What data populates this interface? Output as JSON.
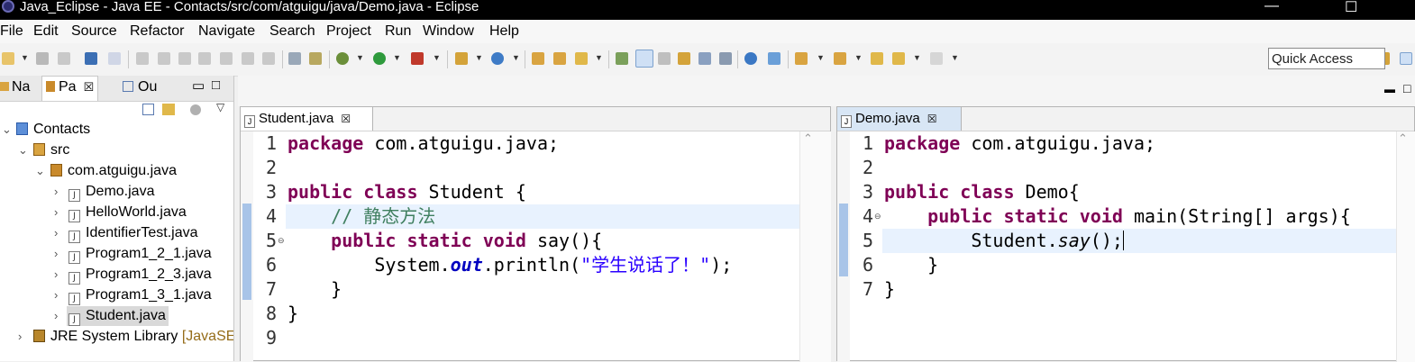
{
  "window": {
    "title": "Java_Eclipse - Java EE - Contacts/src/com/atguigu/java/Demo.java - Eclipse",
    "minimize": "—",
    "maximize": "☐"
  },
  "menubar": {
    "items": [
      "File",
      "Edit",
      "Source",
      "Refactor",
      "Navigate",
      "Search",
      "Project",
      "Run",
      "Window",
      "Help"
    ]
  },
  "toolbar": {
    "quick_access": "Quick Access"
  },
  "left_panel": {
    "tabs": [
      {
        "label": "Na",
        "icon": "navigator-icon"
      },
      {
        "label": "Pa",
        "icon": "package-explorer-icon"
      },
      {
        "label": "Ou",
        "icon": "outline-icon"
      }
    ],
    "close_glyph": "☒",
    "tree": [
      {
        "label": "Contacts",
        "icon": "project-icon"
      },
      {
        "label": "src",
        "icon": "source-folder-icon"
      },
      {
        "label": "com.atguigu.java",
        "icon": "package-icon"
      },
      {
        "label": "Demo.java",
        "icon": "java-file-icon"
      },
      {
        "label": "HelloWorld.java",
        "icon": "java-file-icon"
      },
      {
        "label": "IdentifierTest.java",
        "icon": "java-file-icon"
      },
      {
        "label": "Program1_2_1.java",
        "icon": "java-file-icon"
      },
      {
        "label": "Program1_2_3.java",
        "icon": "java-file-icon"
      },
      {
        "label": "Program1_3_1.java",
        "icon": "java-file-icon"
      },
      {
        "label": "Student.java",
        "icon": "java-file-icon"
      },
      {
        "label": "JRE System Library",
        "suffix": "[JavaSE-",
        "icon": "library-icon"
      }
    ]
  },
  "editors": [
    {
      "tab": "Student.java",
      "lines": [
        "1",
        "2",
        "3",
        "4",
        "5",
        "6",
        "7",
        "8",
        "9"
      ],
      "code": {
        "l1a": "package",
        "l1b": " com.atguigu.java;",
        "l3a": "public",
        "l3b": " ",
        "l3c": "class",
        "l3d": " Student {",
        "l4": "    // 静态方法",
        "l5a": "    ",
        "l5b": "public",
        "l5c": " ",
        "l5d": "static",
        "l5e": " ",
        "l5f": "void",
        "l5g": " say(){",
        "l6a": "        System.",
        "l6b": "out",
        "l6c": ".println(",
        "l6d": "\"学生说话了！\"",
        "l6e": ");",
        "l7": "    }",
        "l8": "}"
      }
    },
    {
      "tab": "Demo.java",
      "lines": [
        "1",
        "2",
        "3",
        "4",
        "5",
        "6",
        "7"
      ],
      "code": {
        "l1a": "package",
        "l1b": " com.atguigu.java;",
        "l3a": "public",
        "l3b": " ",
        "l3c": "class",
        "l3d": " Demo{",
        "l4a": "    ",
        "l4b": "public",
        "l4c": " ",
        "l4d": "static",
        "l4e": " ",
        "l4f": "void",
        "l4g": " main(String[] args){",
        "l5a": "        Student.",
        "l5b": "say",
        "l5c": "();",
        "l6": "    }",
        "l7": "}"
      }
    }
  ],
  "colors": {
    "keyword": "#7f0055",
    "comment": "#3f7f5f",
    "string": "#2a00ff",
    "field": "#0000c0",
    "current_line": "#e8f2fe"
  }
}
